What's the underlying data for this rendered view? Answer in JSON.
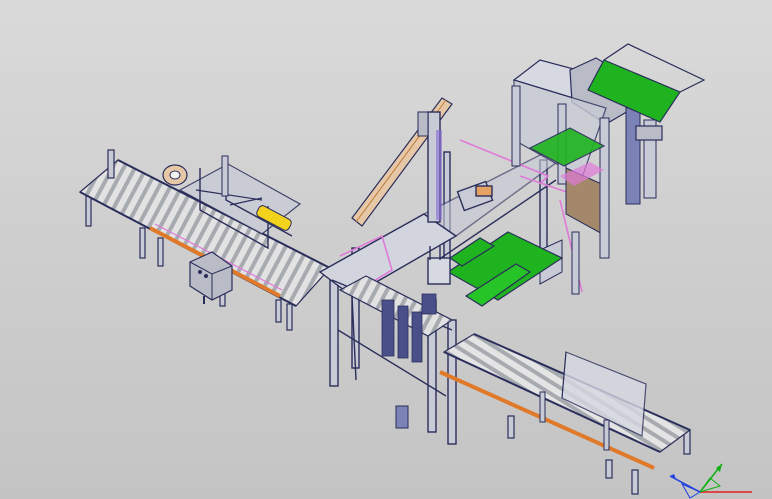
{
  "viewport": {
    "background_top": "#dadada",
    "background_bottom": "#c4c4c4"
  },
  "model": {
    "palette": {
      "frame": "#c8cad6",
      "frame_edge": "#2a2e5a",
      "conveyor_bed": "#9fa3a8",
      "roller": "#e4e4e4",
      "guard_green": "#1fb41f",
      "rail_orange": "#e07a2a",
      "pink_outline": "#e07ad8",
      "belt_tan": "#e6c8a6",
      "housing_grey": "#b9bcc7",
      "panel_brown": "#a3886a",
      "tape_yellow": "#f2d21a"
    },
    "icons": [
      "orientation-triad-icon"
    ]
  },
  "triad": {
    "axis_colors": {
      "x": "#e02020",
      "y": "#10b010",
      "z": "#2040e0"
    }
  }
}
